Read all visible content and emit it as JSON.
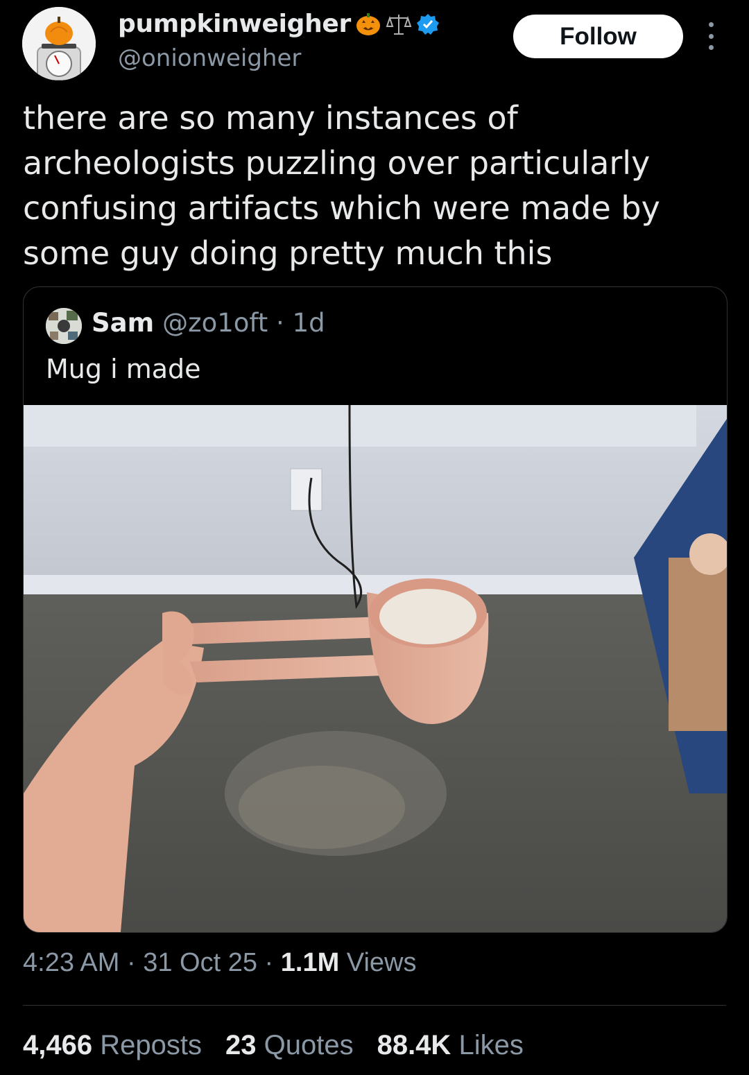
{
  "author": {
    "display_name": "pumpkinweigher",
    "handle": "@onionweigher",
    "name_emojis": [
      "jack-o-lantern-icon",
      "scales-icon",
      "verified-badge-icon"
    ],
    "verified_color": "#1d9bf0"
  },
  "actions": {
    "follow_label": "Follow"
  },
  "tweet": {
    "text": "there are so many instances of archeologists puzzling over particularly confusing artifacts which were made by some guy doing pretty much this"
  },
  "quoted": {
    "name": "Sam",
    "handle": "@zo1oft · 1d",
    "text": "Mug i made"
  },
  "meta": {
    "time": "4:23 AM",
    "sep1": " · ",
    "date": "31 Oct 25",
    "sep2": " · ",
    "views_count": "1.1M",
    "views_label": " Views"
  },
  "stats": {
    "reposts_count": "4,466",
    "reposts_label": "Reposts",
    "quotes_count": "23",
    "quotes_label": "Quotes",
    "likes_count": "88.4K",
    "likes_label": "Likes"
  },
  "colors": {
    "background": "#000000",
    "text": "#e7e9ea",
    "muted": "#8b98a5",
    "border": "#2f3336"
  }
}
